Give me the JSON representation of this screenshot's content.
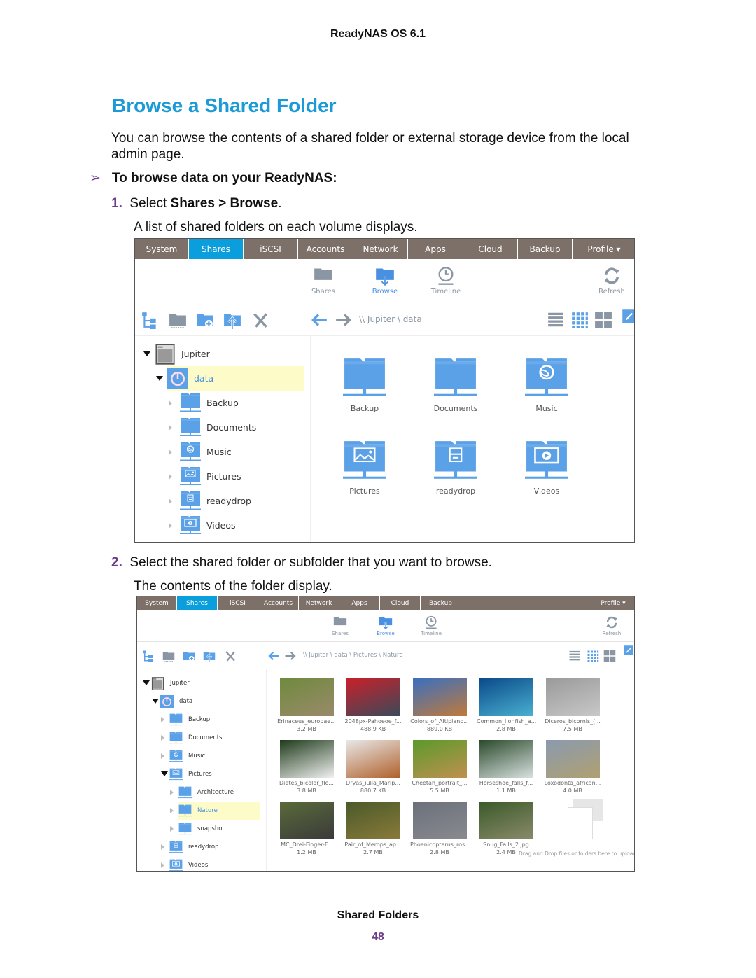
{
  "header": "ReadyNAS OS 6.1",
  "title": "Browse a Shared Folder",
  "intro": "You can browse the contents of a shared folder or external storage device from the local admin page.",
  "procedure": "To browse data on your ReadyNAS:",
  "steps": [
    {
      "num": "1.",
      "pre": "Select ",
      "b1": "Shares",
      "mid": " > ",
      "b2": "Browse",
      "post": ".",
      "result": "A list of shared folders on each volume displays."
    },
    {
      "num": "2.",
      "text": "Select the shared folder or subfolder that you want to browse.",
      "result": "The contents of the folder display."
    }
  ],
  "colors": {
    "nav": "#7d7068",
    "active_tab": "#0a9fdc",
    "folder": "#5aa1e8",
    "title": "#1a9ad6",
    "selected": "#fdfbc8"
  },
  "nav_tabs": [
    "System",
    "Shares",
    "iSCSI",
    "Accounts",
    "Network",
    "Apps",
    "Cloud",
    "Backup",
    "Profile ▾"
  ],
  "active_tab": "Shares",
  "subnav": [
    {
      "label": "Shares",
      "icon": "folder-icon"
    },
    {
      "label": "Browse",
      "icon": "browse-folder-icon"
    },
    {
      "label": "Timeline",
      "icon": "clock-icon"
    }
  ],
  "refresh": "Refresh",
  "toolbar_icons": [
    "tree-view-icon",
    "new-folder-icon",
    "add-folder-icon",
    "upload-icon",
    "delete-icon",
    "back-arrow-icon",
    "forward-arrow-icon",
    "list-view-icon",
    "small-grid-icon",
    "large-grid-icon",
    "popout-icon"
  ],
  "screen1": {
    "path": "\\\\ Jupiter \\ data",
    "tree": [
      {
        "label": "Jupiter",
        "icon": "nas-icon",
        "state": "open",
        "level": 0
      },
      {
        "label": "data",
        "icon": "volume-icon",
        "state": "open",
        "level": 1,
        "selected": true
      },
      {
        "label": "Backup",
        "icon": "share-folder-icon",
        "state": "closed",
        "level": 2
      },
      {
        "label": "Documents",
        "icon": "share-folder-icon",
        "state": "closed",
        "level": 2
      },
      {
        "label": "Music",
        "icon": "music-folder-icon",
        "state": "closed",
        "level": 2
      },
      {
        "label": "Pictures",
        "icon": "pictures-folder-icon",
        "state": "closed",
        "level": 2
      },
      {
        "label": "readydrop",
        "icon": "readydrop-folder-icon",
        "state": "closed",
        "level": 2
      },
      {
        "label": "Videos",
        "icon": "video-folder-icon",
        "state": "closed",
        "level": 2
      }
    ],
    "grid": [
      {
        "label": "Backup",
        "icon": "share-folder-icon"
      },
      {
        "label": "Documents",
        "icon": "share-folder-icon"
      },
      {
        "label": "Music",
        "icon": "music-folder-icon"
      },
      {
        "label": "Pictures",
        "icon": "pictures-folder-icon"
      },
      {
        "label": "readydrop",
        "icon": "readydrop-folder-icon"
      },
      {
        "label": "Videos",
        "icon": "video-folder-icon"
      }
    ]
  },
  "screen2": {
    "path": "\\\\ Jupiter \\ data \\ Pictures \\ Nature",
    "tree": [
      {
        "label": "Jupiter",
        "icon": "nas-icon",
        "state": "open",
        "level": 0
      },
      {
        "label": "data",
        "icon": "volume-icon",
        "state": "open",
        "level": 1
      },
      {
        "label": "Backup",
        "icon": "share-folder-icon",
        "state": "closed",
        "level": 2
      },
      {
        "label": "Documents",
        "icon": "share-folder-icon",
        "state": "closed",
        "level": 2
      },
      {
        "label": "Music",
        "icon": "music-folder-icon",
        "state": "closed",
        "level": 2
      },
      {
        "label": "Pictures",
        "icon": "pictures-folder-icon",
        "state": "open",
        "level": 2
      },
      {
        "label": "Architecture",
        "icon": "share-folder-icon",
        "state": "closed",
        "level": 3
      },
      {
        "label": "Nature",
        "icon": "share-folder-icon",
        "state": "closed",
        "level": 3,
        "selected": true
      },
      {
        "label": "snapshot",
        "icon": "share-folder-icon",
        "state": "closed",
        "level": 3
      },
      {
        "label": "readydrop",
        "icon": "readydrop-folder-icon",
        "state": "closed",
        "level": 2
      },
      {
        "label": "Videos",
        "icon": "video-folder-icon",
        "state": "closed",
        "level": 2
      }
    ],
    "files": [
      {
        "name": "Erinaceus_europae...",
        "size": "3.2 MB",
        "c": [
          "#6f8a3e",
          "#9a8a6a"
        ]
      },
      {
        "name": "2048px-Pahoeoe_f...",
        "size": "488.9 KB",
        "c": [
          "#c8202a",
          "#3a4a5a"
        ]
      },
      {
        "name": "Colors_of_Altiplano...",
        "size": "889.0 KB",
        "c": [
          "#3a6fc0",
          "#c07a3a"
        ]
      },
      {
        "name": "Common_lionfish_a...",
        "size": "2.8 MB",
        "c": [
          "#0a4a8a",
          "#4ab0d0"
        ]
      },
      {
        "name": "Diceros_bicornis_(...",
        "size": "7.5 MB",
        "c": [
          "#9a9a9a",
          "#c8c8c8"
        ]
      },
      {
        "name": "Dietes_bicolor_flo...",
        "size": "3.8 MB",
        "c": [
          "#1e3a1a",
          "#f0f0f0"
        ]
      },
      {
        "name": "Dryas_iulia_Marip...",
        "size": "880.7 KB",
        "c": [
          "#e8e8e8",
          "#b0602a"
        ]
      },
      {
        "name": "Cheetah_portrait_...",
        "size": "5.5 MB",
        "c": [
          "#5a9a2a",
          "#c09050"
        ]
      },
      {
        "name": "Horseshoe_falls_f...",
        "size": "1.1 MB",
        "c": [
          "#2a4a2a",
          "#d8e0e0"
        ]
      },
      {
        "name": "Loxodonta_african...",
        "size": "4.0 MB",
        "c": [
          "#8a9ab0",
          "#b0a070"
        ]
      },
      {
        "name": "MC_Drei-Finger-F...",
        "size": "1.2 MB",
        "c": [
          "#5a6a3a",
          "#3a3a3a"
        ]
      },
      {
        "name": "Pair_of_Merops_ap...",
        "size": "2.7 MB",
        "c": [
          "#4a5a2a",
          "#8a7a3a"
        ]
      },
      {
        "name": "Phoenicopterus_ros...",
        "size": "2.8 MB",
        "c": [
          "#6a707a",
          "#8a8a90"
        ]
      },
      {
        "name": "Snug_Falls_2.jpg",
        "size": "2.4 MB",
        "c": [
          "#3a5a2a",
          "#8a8a6a"
        ]
      }
    ],
    "dropzone": "Drag and Drop files or folders here to upload"
  },
  "footer": {
    "section": "Shared Folders",
    "page": "48"
  }
}
